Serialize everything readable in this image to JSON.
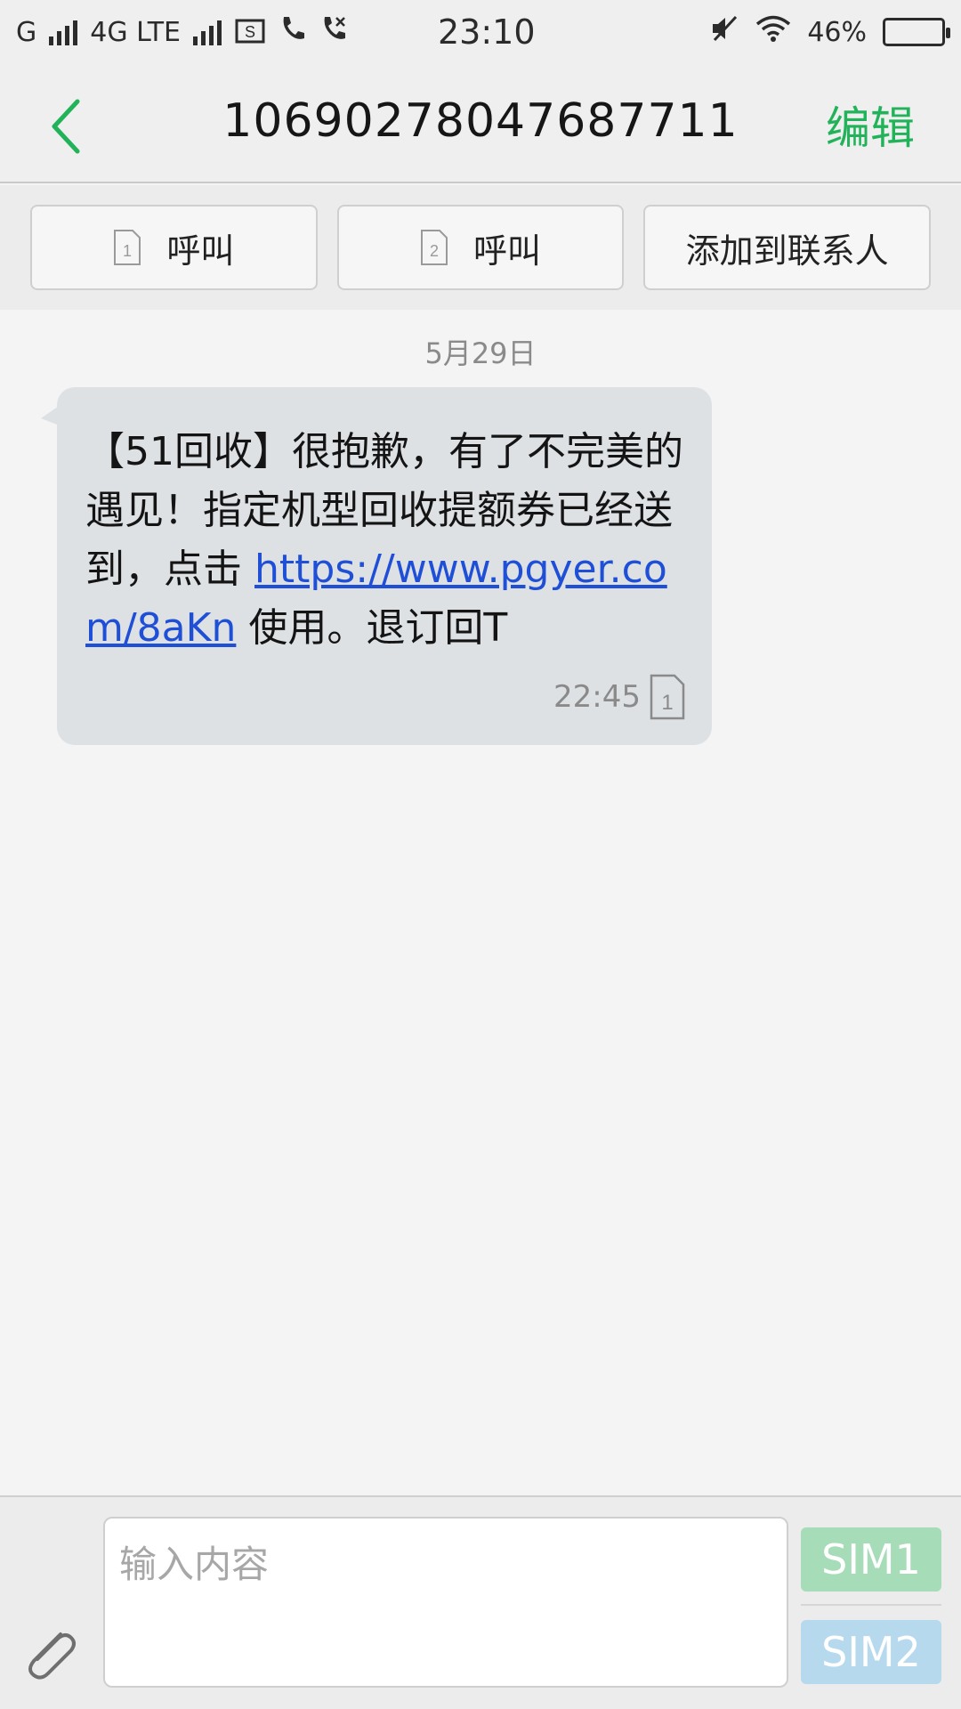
{
  "status_bar": {
    "carrier1": "G",
    "carrier2": "4G LTE",
    "time": "23:10",
    "battery": "46%",
    "battery_level": 0.46,
    "icons": [
      "signal-icon",
      "signal-icon",
      "screenshot-icon",
      "call-icon",
      "call-icon",
      "mute-icon",
      "wifi-icon",
      "battery-icon"
    ]
  },
  "header": {
    "title": "10690278047687711",
    "edit_label": "编辑",
    "accent_color": "#22b35a"
  },
  "actions": {
    "call_sim1": "呼叫",
    "call_sim2": "呼叫",
    "add_contact": "添加到联系人",
    "sim1_number": "1",
    "sim2_number": "2"
  },
  "conversation": {
    "date": "5月29日",
    "message": {
      "text_before": "【51回收】很抱歉，有了不完美的遇见！指定机型回收提额券已经送到，点击 ",
      "link": "https://www.pgyer.com/8aKn",
      "text_after": " 使用。退订回T",
      "time": "22:45",
      "sim_number": "1"
    }
  },
  "input_bar": {
    "placeholder": "输入内容",
    "sim1_label": "SIM1",
    "sim2_label": "SIM2",
    "sim1_color": "#a6dcb7",
    "sim2_color": "#b7d9ee"
  }
}
